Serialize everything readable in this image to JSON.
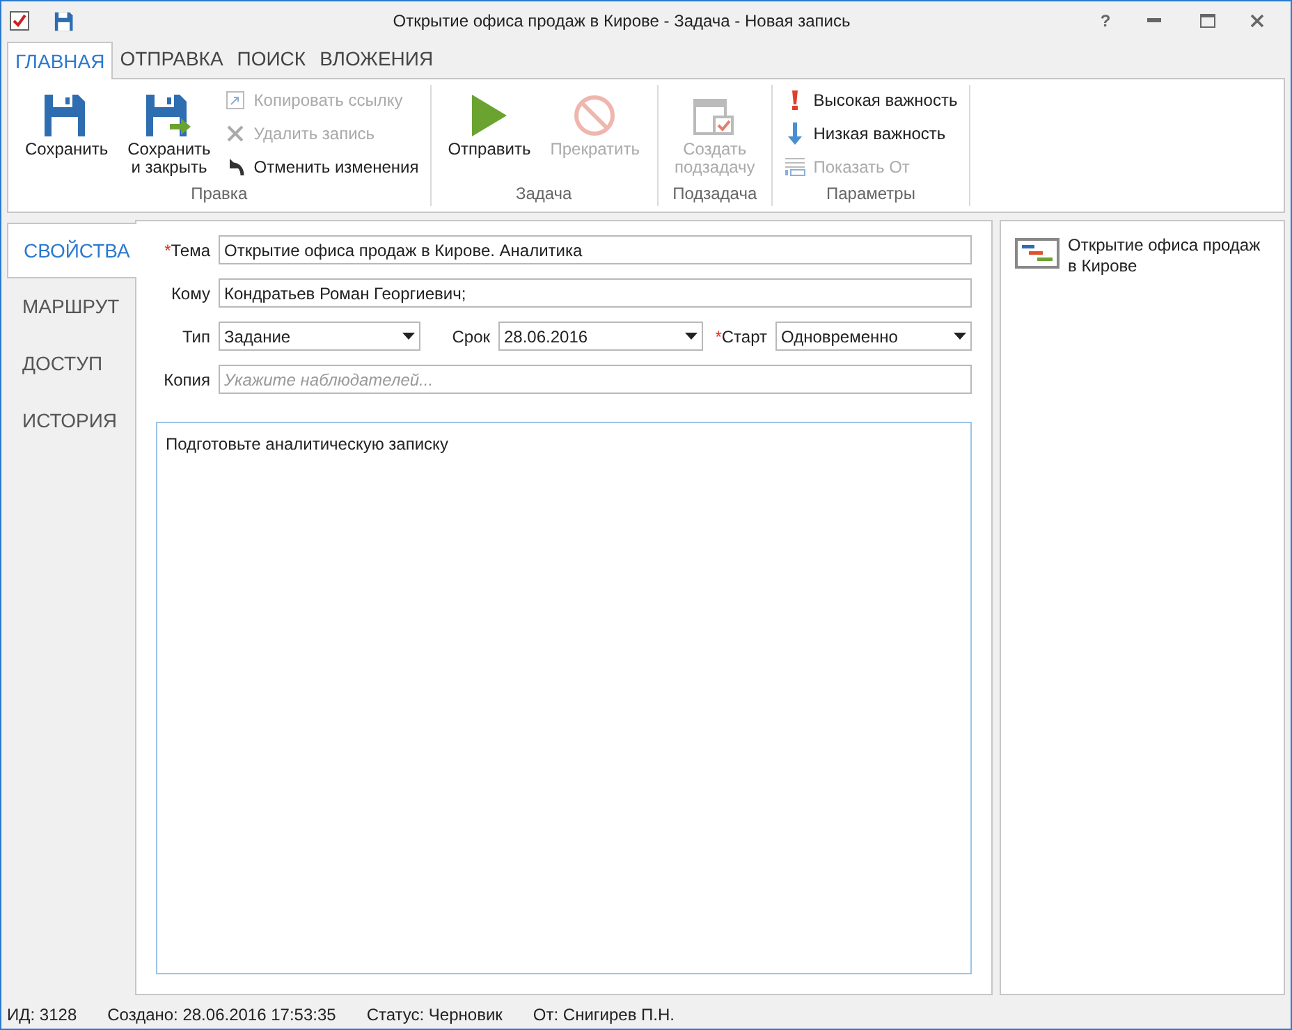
{
  "window": {
    "title": "Открытие офиса продаж в Кирове - Задача - Новая запись",
    "help": "?"
  },
  "ribbon_tabs": [
    {
      "label": "ГЛАВНАЯ",
      "selected": true
    },
    {
      "label": "ОТПРАВКА",
      "selected": false
    },
    {
      "label": "ПОИСК",
      "selected": false
    },
    {
      "label": "ВЛОЖЕНИЯ",
      "selected": false
    }
  ],
  "ribbon_groups": [
    {
      "label": "Правка",
      "items": [
        {
          "kind": "large",
          "label": "Сохранить",
          "disabled": false
        },
        {
          "kind": "large",
          "label": "Сохранить\nи закрыть",
          "disabled": false
        },
        {
          "kind": "small",
          "label": "Копировать ссылку",
          "disabled": true
        },
        {
          "kind": "small",
          "label": "Удалить запись",
          "disabled": true
        },
        {
          "kind": "small",
          "label": "Отменить изменения",
          "disabled": false
        }
      ]
    },
    {
      "label": "Задача",
      "items": [
        {
          "kind": "large",
          "label": "Отправить",
          "disabled": false
        },
        {
          "kind": "large",
          "label": "Прекратить",
          "disabled": true
        }
      ]
    },
    {
      "label": "Подзадача",
      "items": [
        {
          "kind": "large",
          "label": "Создать\nподзадачу",
          "disabled": true
        }
      ]
    },
    {
      "label": "Параметры",
      "items": [
        {
          "kind": "small",
          "label": "Высокая важность",
          "disabled": false
        },
        {
          "kind": "small",
          "label": "Низкая важность",
          "disabled": false
        },
        {
          "kind": "small",
          "label": "Показать От",
          "disabled": true
        }
      ]
    }
  ],
  "side_tabs": [
    {
      "label": "СВОЙСТВА",
      "selected": true
    },
    {
      "label": "МАРШРУТ",
      "selected": false
    },
    {
      "label": "ДОСТУП",
      "selected": false
    },
    {
      "label": "ИСТОРИЯ",
      "selected": false
    }
  ],
  "form": {
    "subject": {
      "required_mark": "*",
      "label": "Тема",
      "value": "Открытие офиса продаж в Кирове. Аналитика"
    },
    "to": {
      "label": "Кому",
      "value": "Кондратьев Роман Георгиевич;"
    },
    "type": {
      "label": "Тип",
      "value": "Задание"
    },
    "due": {
      "label": "Срок",
      "value": "28.06.2016"
    },
    "start": {
      "required_mark": "*",
      "label": "Старт",
      "value": "Одновременно"
    },
    "cc": {
      "label": "Копия",
      "placeholder": "Укажите наблюдателей..."
    },
    "body": "Подготовьте аналитическую записку"
  },
  "related": [
    {
      "label": "Открытие офиса продаж в Кирове"
    }
  ],
  "status_bar": [
    "ИД: 3128",
    "Создано: 28.06.2016 17:53:35",
    "Статус: Черновик",
    "От: Снигирев П.Н."
  ]
}
